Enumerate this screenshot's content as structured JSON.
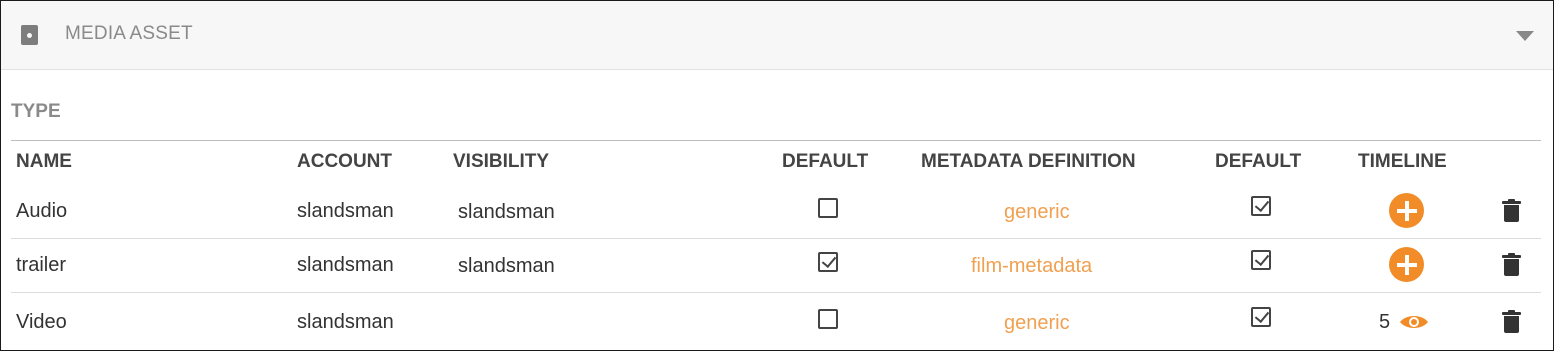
{
  "panel": {
    "title": "MEDIA ASSET",
    "icon": "media-asset-icon",
    "collapse_icon": "chevron-down-icon"
  },
  "section": {
    "title": "TYPE"
  },
  "table": {
    "headers": {
      "name": "NAME",
      "account": "ACCOUNT",
      "visibility": "VISIBILITY",
      "default": "DEFAULT",
      "metadata_definition": "METADATA DEFINITION",
      "metadata_default": "DEFAULT",
      "timeline": "TIMELINE"
    },
    "rows": [
      {
        "name": "Audio",
        "account": "slandsman",
        "visibility": "slandsman",
        "default_checked": false,
        "metadata_definition": "generic",
        "metadata_default_checked": true,
        "timeline": "add"
      },
      {
        "name": "trailer",
        "account": "slandsman",
        "visibility": "slandsman",
        "default_checked": true,
        "metadata_definition": "film-metadata",
        "metadata_default_checked": true,
        "timeline": "add"
      },
      {
        "name": "Video",
        "account": "slandsman",
        "visibility": "",
        "default_checked": false,
        "metadata_definition": "generic",
        "metadata_default_checked": true,
        "timeline": "view",
        "timeline_count": "5"
      }
    ]
  },
  "colors": {
    "accent": "#f28c28",
    "link": "#f0a050",
    "header_bg": "#f7f7f7"
  }
}
